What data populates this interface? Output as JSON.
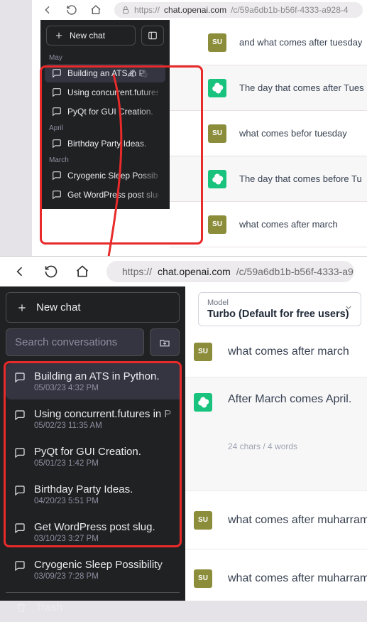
{
  "top": {
    "url_host": "chat.openai.com",
    "url_path": "/c/59a6db1b-b56f-4333-a928-4",
    "sidebar": {
      "new_chat": "New chat",
      "months": {
        "may": "May",
        "april": "April",
        "march": "March"
      },
      "items": [
        {
          "title": "Building an ATS in Py",
          "selected": true
        },
        {
          "title": "Using concurrent.futures in Py"
        },
        {
          "title": "PyQt for GUI Creation."
        },
        {
          "title": "Birthday Party Ideas."
        },
        {
          "title": "Cryogenic Sleep Possibility"
        },
        {
          "title": "Get WordPress post slug."
        }
      ]
    },
    "rows": [
      {
        "who": "su",
        "text": "and what comes after tuesday"
      },
      {
        "who": "gpt",
        "text": "The day that comes after Tues"
      },
      {
        "who": "su",
        "text": "what comes befor tuesday"
      },
      {
        "who": "gpt",
        "text": "The day that comes before Tu"
      },
      {
        "who": "su",
        "text": "what comes after march"
      }
    ]
  },
  "bottom": {
    "url_host": "chat.openai.com",
    "url_path": "/c/59a6db1b-b56f-4333-a928",
    "sidebar": {
      "new_chat": "New chat",
      "search_placeholder": "Search conversations",
      "items": [
        {
          "title": "Building an ATS in Python.",
          "date": "05/03/23 4:32 PM",
          "selected": true
        },
        {
          "title": "Using concurrent.futures in P",
          "date": "05/02/23 11:35 AM"
        },
        {
          "title": "PyQt for GUI Creation.",
          "date": "05/01/23 1:42 PM"
        },
        {
          "title": "Birthday Party Ideas.",
          "date": "04/20/23 5:51 PM"
        },
        {
          "title": "Get WordPress post slug.",
          "date": "03/10/23 3:27 PM"
        },
        {
          "title": "Cryogenic Sleep Possibility",
          "date": "03/09/23 7:28 PM"
        }
      ],
      "trash": "Trash"
    },
    "model": {
      "label": "Model",
      "value": "Turbo (Default for free users)"
    },
    "rows": [
      {
        "who": "su",
        "text": "what comes after march"
      },
      {
        "who": "gpt",
        "text": "After March comes April.",
        "meta": "24 chars / 4 words"
      },
      {
        "who": "su",
        "text": "what comes after muharram"
      },
      {
        "who": "su",
        "text": "what comes after muharram"
      }
    ]
  }
}
